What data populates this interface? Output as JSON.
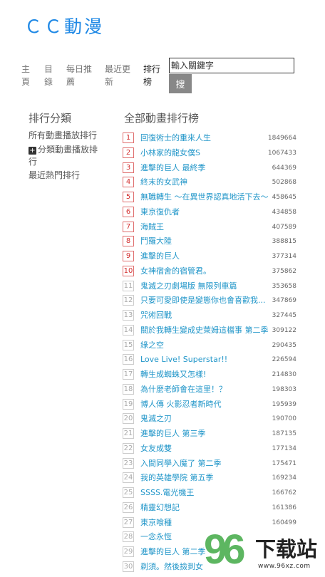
{
  "logo": "ＣＣ動漫",
  "nav": [
    {
      "label": "主\n頁",
      "active": false
    },
    {
      "label": "目\n錄",
      "active": false
    },
    {
      "label": "每日推\n薦",
      "active": false
    },
    {
      "label": "最近更\n新",
      "active": false
    },
    {
      "label": "排行\n榜",
      "active": true
    }
  ],
  "search": {
    "placeholder": "輸入關鍵字",
    "button": "搜"
  },
  "sidebar": {
    "title": "排行分類",
    "items": [
      "所有動畫播放排行",
      "分類動畫播放排\n行",
      "最近熱門排行"
    ]
  },
  "main": {
    "title": "全部動畫排行榜"
  },
  "ranking": [
    {
      "rank": "1",
      "title": "回復術士的重來人生",
      "count": "1849664"
    },
    {
      "rank": "2",
      "title": "小林家的龍女僕S",
      "count": "1067433"
    },
    {
      "rank": "3",
      "title": "進擊的巨人 最終季",
      "count": "644369"
    },
    {
      "rank": "4",
      "title": "終末的女武神",
      "count": "502868"
    },
    {
      "rank": "5",
      "title": "無職轉生 ～在異世界認真地活下去～",
      "count": "458645"
    },
    {
      "rank": "6",
      "title": "東京復仇者",
      "count": "434858"
    },
    {
      "rank": "7",
      "title": "海賊王",
      "count": "407589"
    },
    {
      "rank": "8",
      "title": "鬥羅大陸",
      "count": "388815"
    },
    {
      "rank": "9",
      "title": "進擊的巨人",
      "count": "377314"
    },
    {
      "rank": "10",
      "title": "女神宿舍的宿管君。",
      "count": "375862"
    },
    {
      "rank": "11",
      "title": "鬼滅之刃劇場版 無限列車篇",
      "count": "353658"
    },
    {
      "rank": "12",
      "title": "只要可愛即使是變態你也會喜歡我...",
      "count": "347869"
    },
    {
      "rank": "13",
      "title": "咒術回戰",
      "count": "327445"
    },
    {
      "rank": "14",
      "title": "關於我轉生變成史萊姆這檔事 第二季",
      "count": "309122"
    },
    {
      "rank": "15",
      "title": "綠之空",
      "count": "290435"
    },
    {
      "rank": "16",
      "title": "Love Live! Superstar!!",
      "count": "226594"
    },
    {
      "rank": "17",
      "title": "轉生成蜘蛛又怎樣!",
      "count": "214830"
    },
    {
      "rank": "18",
      "title": "為什麼老師會在這里！？",
      "count": "198303"
    },
    {
      "rank": "19",
      "title": "博人傳 火影忍者新時代",
      "count": "195939"
    },
    {
      "rank": "20",
      "title": "鬼滅之刃",
      "count": "190700"
    },
    {
      "rank": "21",
      "title": "進擊的巨人 第三季",
      "count": "187135"
    },
    {
      "rank": "22",
      "title": "女友成雙",
      "count": "177134"
    },
    {
      "rank": "23",
      "title": "入間同學入魔了 第二季",
      "count": "175471"
    },
    {
      "rank": "24",
      "title": "我的英雄學院 第五季",
      "count": "169234"
    },
    {
      "rank": "25",
      "title": "SSSS.電光機王",
      "count": "166762"
    },
    {
      "rank": "26",
      "title": "精靈幻想記",
      "count": "161386"
    },
    {
      "rank": "27",
      "title": "東京喰種",
      "count": "160499"
    },
    {
      "rank": "28",
      "title": "一念永恆",
      "count": ""
    },
    {
      "rank": "29",
      "title": "進擊的巨人 第二季",
      "count": ""
    },
    {
      "rank": "30",
      "title": "剃須。然後撿到女",
      "count": ""
    }
  ],
  "watermark": {
    "logo_digits": "96",
    "text": "下载站",
    "url": "www.96xz.com"
  },
  "colors": {
    "logo": "#1e88e5",
    "link": "#2196c9",
    "top_rank": "#d32f2f"
  }
}
